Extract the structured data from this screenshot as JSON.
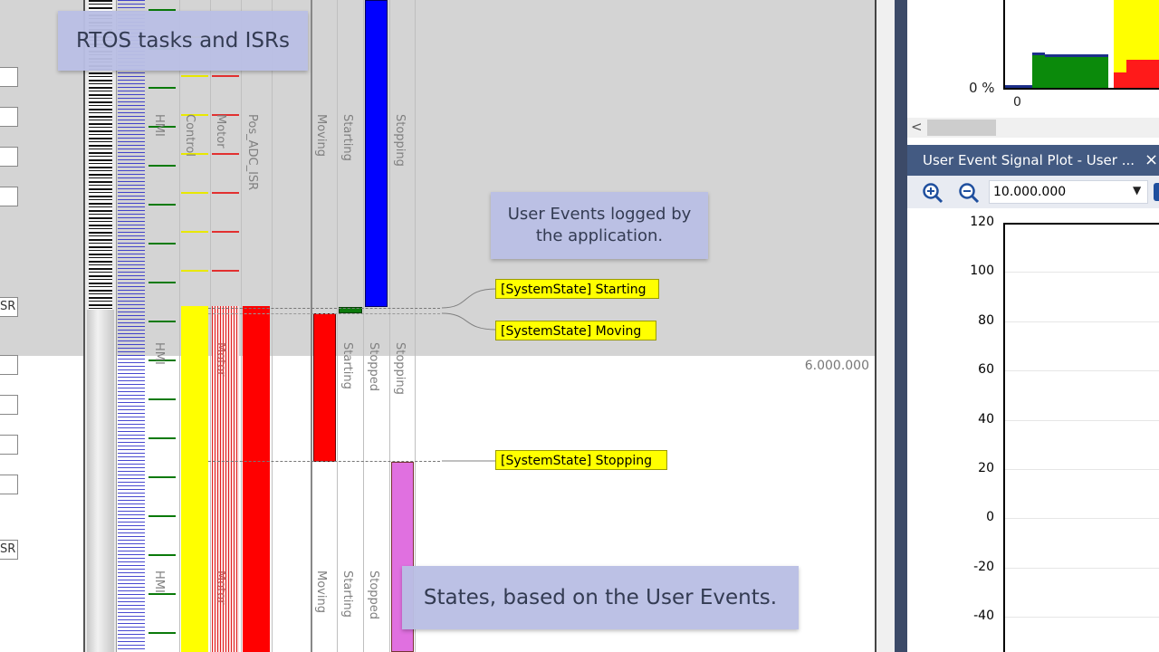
{
  "callouts": {
    "tasks": "RTOS tasks and ISRs",
    "user_events": "User Events logged by\nthe application.",
    "states": "States, based on the User Events."
  },
  "left_labels": {
    "isr_1": "SR",
    "isr_2": "SR"
  },
  "columns_upper": [
    "HMI",
    "Control",
    "Motor",
    "Pos_ADC_ISR",
    "Moving",
    "Starting",
    "Stopping"
  ],
  "columns_lower": [
    "HMI",
    "Motor",
    "Starting",
    "Stopped",
    "Stopping"
  ],
  "columns_bottom": [
    "HMI",
    "Motor",
    "Moving",
    "Starting",
    "Stopped"
  ],
  "events": {
    "starting": "[SystemState] Starting",
    "moving": "[SystemState] Moving",
    "stopping": "[SystemState] Stopping"
  },
  "timestamp": "6.000.000",
  "histogram": {
    "ylabel": "0 %",
    "xlabel": "0",
    "scroll_left": "<"
  },
  "signal_plot": {
    "title": "User Event Signal Plot - User ...",
    "close": "×",
    "zoom_value": "10.000.000",
    "y_ticks": [
      "120",
      "100",
      "80",
      "60",
      "40",
      "20",
      "0",
      "-20",
      "-40"
    ]
  },
  "colors": {
    "control": "#ffff00",
    "motor": "#ff0000",
    "stopping_state": "#0000ff",
    "moving_state": "#ff0000",
    "stopping_state_lower": "#e070e0",
    "hmi": "#0a7a0a",
    "panel_header": "#435a82"
  }
}
